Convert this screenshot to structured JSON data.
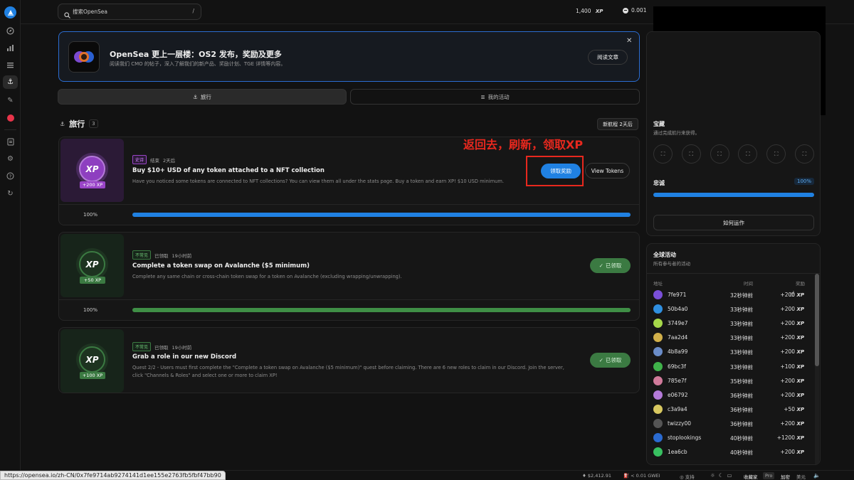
{
  "topbar": {
    "search_placeholder": "搜索OpenSea",
    "search_shortcut": "/",
    "xp_value": "1,400",
    "xp_label": "XP",
    "balance": "0.001"
  },
  "banner": {
    "title": "OpenSea 更上一层楼：OS2 发布，奖励及更多",
    "subtitle": "阅读我们 CMO 的帖子，深入了解我们的新产品、奖励计划、TGE 详情等内容。",
    "read_button": "阅读文章"
  },
  "tabs": {
    "voyages": "旅行",
    "my_activity": "我的活动"
  },
  "section": {
    "title": "旅行",
    "count": "3",
    "new_voyage": "新航程 2天后"
  },
  "annotation": "返回去，刷新，领取XP",
  "quests": [
    {
      "rarity": "史诗",
      "status": "结束",
      "time": "2天后",
      "title": "Buy $10+ USD of any token attached to a NFT collection",
      "description": "Have you noticed some tokens are connected to NFT collections? You can view them all under the stats page. Buy a token and earn XP! $10 USD minimum.",
      "xp_badge": "+200 XP",
      "progress_text": "100%",
      "progress": 1.0,
      "claim_button": "领取奖励",
      "view_button": "View Tokens"
    },
    {
      "rarity": "不常见",
      "status": "已领取",
      "time": "19小时前",
      "title": "Complete a token swap on Avalanche ($5 minimum)",
      "description": "Complete any same chain or cross-chain token swap for a token on Avalanche (excluding wrapping/unwrapping).",
      "xp_badge": "+50 XP",
      "progress_text": "100%",
      "progress": 1.0,
      "claimed_button": "已领取"
    },
    {
      "rarity": "不常见",
      "status": "已领取",
      "time": "19小时前",
      "title": "Grab a role in our new Discord",
      "description_line1": "Quest 2/2 - Users must first complete the \"Complete a token swap on Avalanche ($5 minimum)\" quest before claiming. There are 6 new roles to claim in our Discord. Join the server,",
      "description_line2": "click \"Channels & Roles\" and select one or more to claim XP!",
      "xp_badge": "+100 XP",
      "claimed_button": "已领取"
    }
  ],
  "treasure": {
    "title": "宝藏",
    "subtitle": "通过完成航行来获得。"
  },
  "loyalty": {
    "title": "忠诚",
    "value_text": "100%",
    "value": 1.0,
    "how_it_works": "如何运作"
  },
  "global_activity": {
    "title": "全球活动",
    "subtitle": "所有参与者的活动",
    "col_address": "地址",
    "col_time": "时间",
    "col_reward": "奖励",
    "rows": [
      {
        "address": "7fe971",
        "time": "32秒钟前",
        "reward": "+200",
        "color": "#7a4fd8"
      },
      {
        "address": "50b4a0",
        "time": "33秒钟前",
        "reward": "+200",
        "color": "#2f8fe0"
      },
      {
        "address": "3749e7",
        "time": "33秒钟前",
        "reward": "+200",
        "color": "#a6d84a"
      },
      {
        "address": "7aa2d4",
        "time": "33秒钟前",
        "reward": "+200",
        "color": "#d2b04a"
      },
      {
        "address": "4b8a99",
        "time": "33秒钟前",
        "reward": "+200",
        "color": "#6a8cc8"
      },
      {
        "address": "69bc3f",
        "time": "33秒钟前",
        "reward": "+100",
        "color": "#3fb24a"
      },
      {
        "address": "785e7f",
        "time": "35秒钟前",
        "reward": "+200",
        "color": "#d07a9a"
      },
      {
        "address": "e06792",
        "time": "36秒钟前",
        "reward": "+200",
        "color": "#b47ad8"
      },
      {
        "address": "c3a9a4",
        "time": "36秒钟前",
        "reward": "+50",
        "color": "#d8c860"
      },
      {
        "address": "twizzy00",
        "time": "36秒钟前",
        "reward": "+200",
        "color": "#555555"
      },
      {
        "address": "stoplookings",
        "time": "40秒钟前",
        "reward": "+1200",
        "color": "#2a6ad0"
      },
      {
        "address": "1ea6cb",
        "time": "40秒钟前",
        "reward": "+200",
        "color": "#38c060"
      }
    ],
    "xp_label": "XP"
  },
  "statusbar": {
    "url": "https://opensea.io/zh-CN/0x7fe9714ab9274141d1ee155e2763fb5fbf47bb90",
    "eth_price": "$2,412.91",
    "gas": "< 0.01 GWEI",
    "support": "支持",
    "collector": "收藏家",
    "pro": "Pro",
    "crypto": "加密",
    "usd": "美元"
  }
}
